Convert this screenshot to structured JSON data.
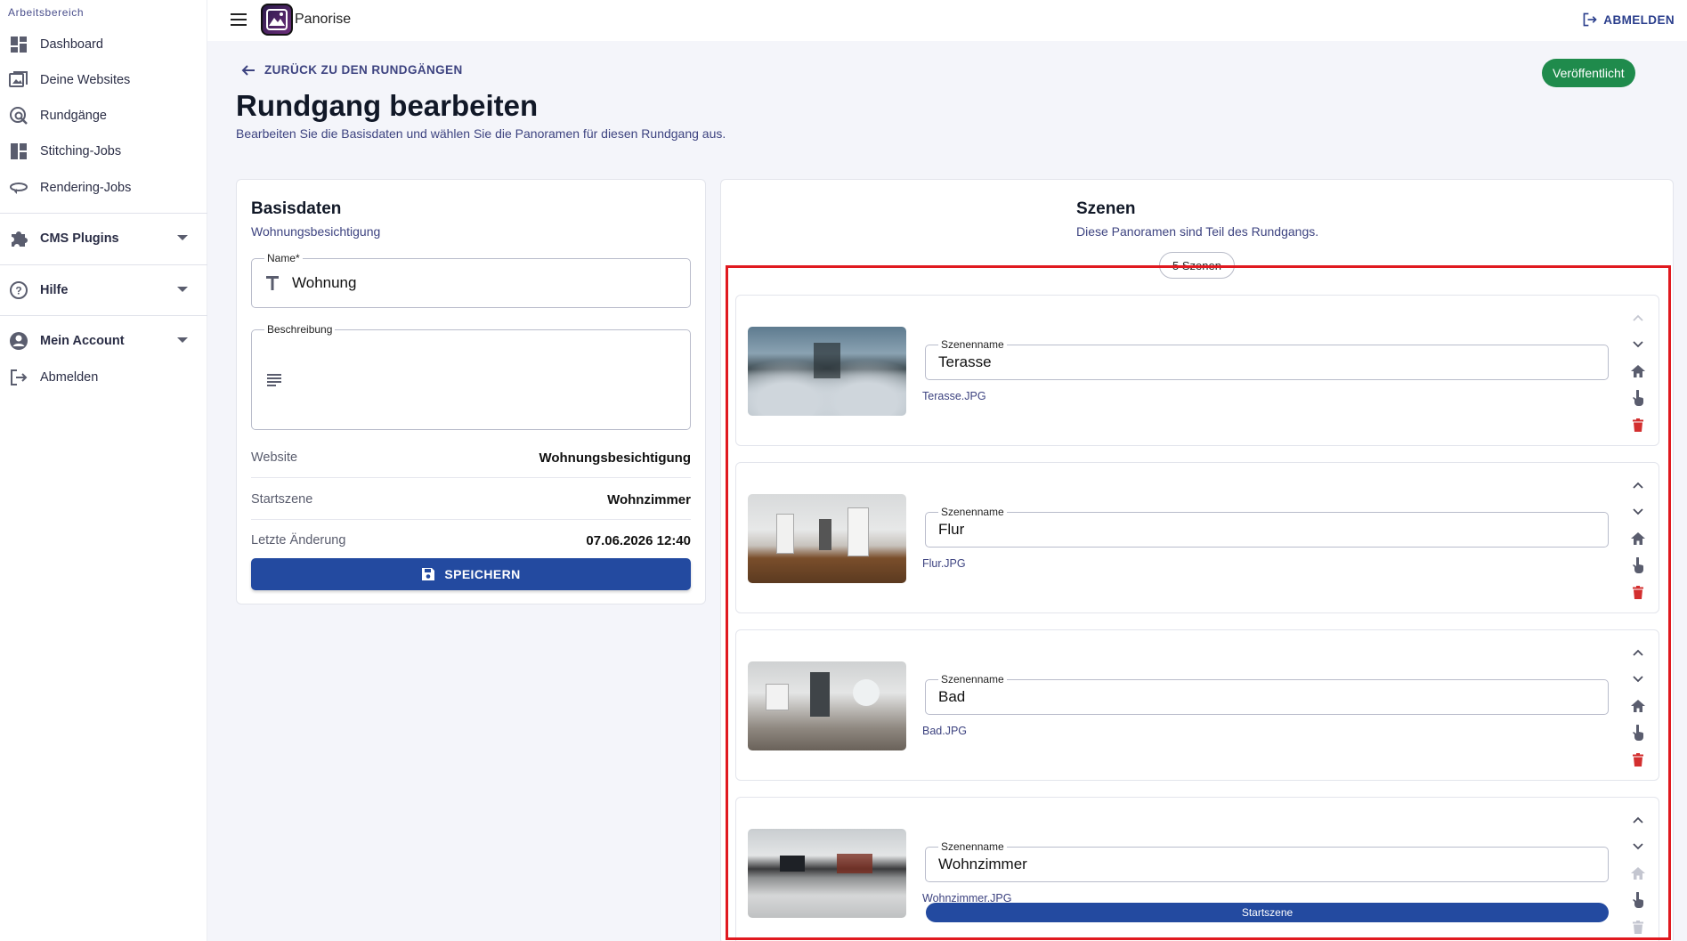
{
  "sidebar": {
    "section_label": "Arbeitsbereich",
    "items": [
      {
        "label": "Dashboard",
        "icon": "dashboard-icon"
      },
      {
        "label": "Deine Websites",
        "icon": "images-icon"
      },
      {
        "label": "Rundgänge",
        "icon": "tour-search-icon"
      },
      {
        "label": "Stitching-Jobs",
        "icon": "grid-icon"
      },
      {
        "label": "Rendering-Jobs",
        "icon": "rotate-icon"
      },
      {
        "label": "CMS Plugins",
        "icon": "puzzle-icon"
      },
      {
        "label": "Hilfe",
        "icon": "help-icon"
      },
      {
        "label": "Mein Account",
        "icon": "account-icon"
      },
      {
        "label": "Abmelden",
        "icon": "logout-icon"
      }
    ]
  },
  "topbar": {
    "app_name": "Panorise",
    "logout_label": "ABMELDEN"
  },
  "header": {
    "back_label": "ZURÜCK ZU DEN RUNDGÄNGEN",
    "title": "Rundgang bearbeiten",
    "subtitle": "Bearbeiten Sie die Basisdaten und wählen Sie die Panoramen für diesen Rundgang aus.",
    "status": "Veröffentlicht"
  },
  "basis": {
    "title": "Basisdaten",
    "subtitle": "Wohnungsbesichtigung",
    "name_label": "Name*",
    "name_value": "Wohnung",
    "description_label": "Beschreibung",
    "description_value": "",
    "rows": [
      {
        "key": "Website",
        "value": "Wohnungsbesichtigung"
      },
      {
        "key": "Startszene",
        "value": "Wohnzimmer"
      },
      {
        "key": "Letzte Änderung",
        "value": "07.06.2026 12:40"
      }
    ],
    "save_label": "SPEICHERN"
  },
  "scenes": {
    "title": "Szenen",
    "subtitle": "Diese Panoramen sind Teil des Rundgangs.",
    "count_label": "5 Szenen",
    "field_label": "Szenenname",
    "start_label": "Startszene",
    "items": [
      {
        "name": "Terasse",
        "file": "Terasse.JPG"
      },
      {
        "name": "Flur",
        "file": "Flur.JPG"
      },
      {
        "name": "Bad",
        "file": "Bad.JPG"
      },
      {
        "name": "Wohnzimmer",
        "file": "Wohnzimmer.JPG"
      }
    ]
  },
  "colors": {
    "primary": "#234aa0",
    "success": "#1f8b4c",
    "danger": "#d32f2f",
    "accent_text": "#3d4380",
    "highlight": "#e0191f"
  }
}
